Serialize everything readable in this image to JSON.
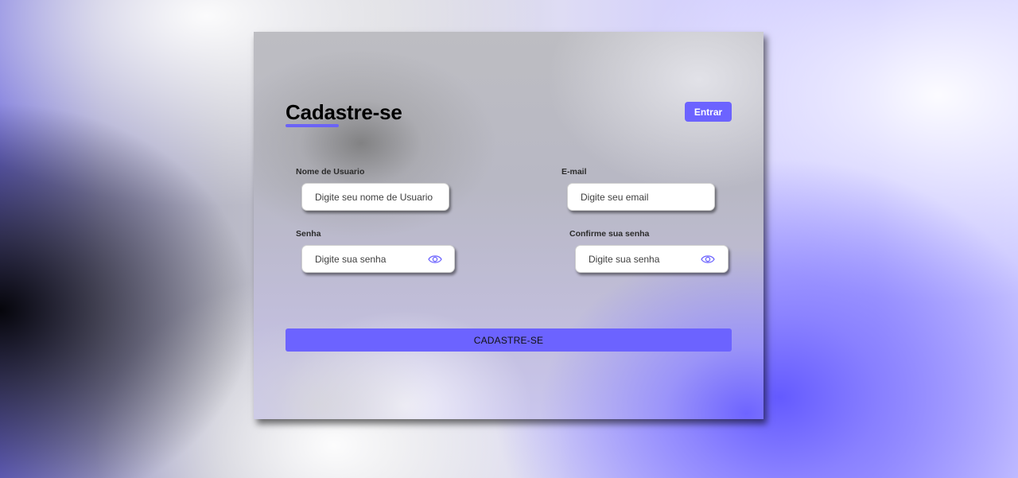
{
  "form": {
    "title": "Cadastre-se",
    "login_button_label": "Entrar",
    "username": {
      "label": "Nome de Usuario",
      "placeholder": "Digite seu nome de Usuario"
    },
    "email": {
      "label": "E-mail",
      "placeholder": "Digite seu email"
    },
    "password": {
      "label": "Senha",
      "placeholder": "Digite sua senha",
      "toggle_icon": "eye-icon"
    },
    "confirm_password": {
      "label": "Confirme sua senha",
      "placeholder": "Digite sua senha",
      "toggle_icon": "eye-icon"
    },
    "submit_label": "CADASTRE-SE"
  },
  "colors": {
    "accent": "#6c63ff",
    "title_text": "#000000",
    "input_background": "#ffffff"
  }
}
